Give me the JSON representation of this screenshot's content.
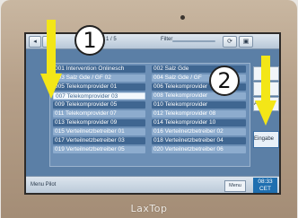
{
  "device": {
    "brand": "LaxTop"
  },
  "toolbar": {
    "back_label": "◂",
    "page_label": "1 / 5",
    "filter_label": "Filter",
    "reload_label": "⟳",
    "save_label": "▣"
  },
  "list": {
    "left_column": [
      "001 Intervention Onlinesch",
      "003 Salz Gde / GF 02",
      "005 Telekomprovider 01",
      "007 Telekomprovider 03",
      "009 Telekomprovider 05",
      "011 Telekomprovider 07",
      "013 Telekomprovider 09",
      "015 Verteilnetzbetreiber 01",
      "017 Verteilnetzbetreiber 03",
      "019 Verteilnetzbetreiber 05"
    ],
    "right_column": [
      "002 Salz Gde",
      "004 Salz Gde / GF",
      "006 Telekomprovider",
      "008 Telekomprovider",
      "010 Telekomprovider",
      "012 Telekomprovider 08",
      "014 Telekomprovider 10",
      "016 Verteilnetzbetreiber 02",
      "018 Verteilnetzbetreiber 04",
      "020 Verteilnetzbetreiber 06"
    ],
    "selected_left_index": 3
  },
  "side_buttons": [
    "",
    "",
    "Al",
    "Eingabe"
  ],
  "footer": {
    "status_text": "Menu Pilot",
    "next_label": "Menu",
    "clock_time": "08:33",
    "clock_date": "CET"
  },
  "annotations": {
    "badge_1": "1",
    "badge_2": "2"
  }
}
